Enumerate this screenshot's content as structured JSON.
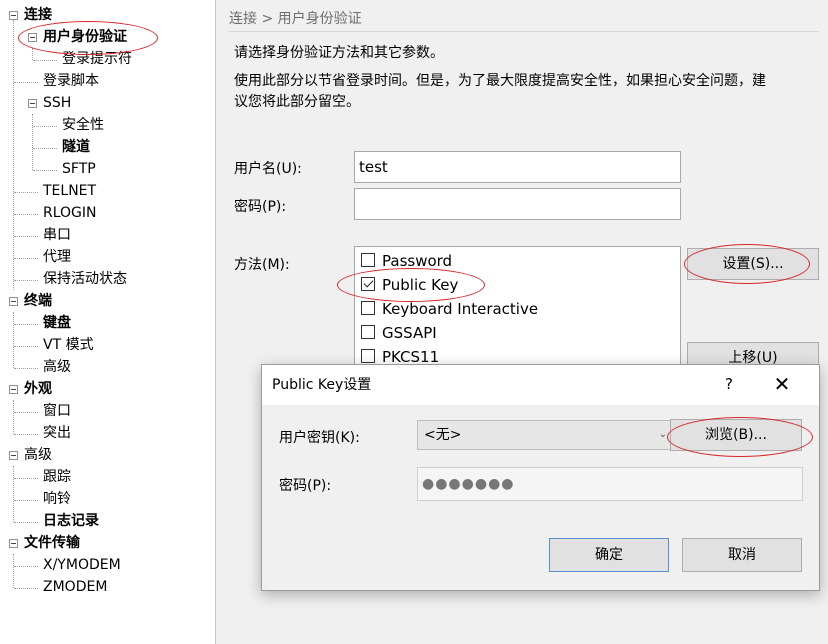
{
  "tree": {
    "items": [
      {
        "label": "连接",
        "bold": true
      },
      {
        "label": "用户身份验证",
        "bold": true
      },
      {
        "label": "登录提示符",
        "bold": false
      },
      {
        "label": "登录脚本",
        "bold": false
      },
      {
        "label": "SSH",
        "bold": false
      },
      {
        "label": "安全性",
        "bold": false
      },
      {
        "label": "隧道",
        "bold": true
      },
      {
        "label": "SFTP",
        "bold": false
      },
      {
        "label": "TELNET",
        "bold": false
      },
      {
        "label": "RLOGIN",
        "bold": false
      },
      {
        "label": "串口",
        "bold": false
      },
      {
        "label": "代理",
        "bold": false
      },
      {
        "label": "保持活动状态",
        "bold": false
      },
      {
        "label": "终端",
        "bold": true
      },
      {
        "label": "键盘",
        "bold": true
      },
      {
        "label": "VT 模式",
        "bold": false
      },
      {
        "label": "高级",
        "bold": false
      },
      {
        "label": "外观",
        "bold": true
      },
      {
        "label": "窗口",
        "bold": false
      },
      {
        "label": "突出",
        "bold": false
      },
      {
        "label": "高级",
        "bold": false
      },
      {
        "label": "跟踪",
        "bold": false
      },
      {
        "label": "响铃",
        "bold": false
      },
      {
        "label": "日志记录",
        "bold": true
      },
      {
        "label": "文件传输",
        "bold": true
      },
      {
        "label": "X/YMODEM",
        "bold": false
      },
      {
        "label": "ZMODEM",
        "bold": false
      }
    ]
  },
  "panel": {
    "breadcrumb": "连接 > 用户身份验证",
    "desc1": "请选择身份验证方法和其它参数。",
    "desc2_line1": "使用此部分以节省登录时间。但是，为了最大限度提高安全性，如果担心安全问题，建",
    "desc2_line2": "议您将此部分留空。",
    "username_label": "用户名(U):",
    "username_value": "test",
    "password_label": "密码(P):",
    "password_value": "",
    "method_label": "方法(M):",
    "methods": [
      {
        "label": "Password",
        "checked": false
      },
      {
        "label": "Public Key",
        "checked": true
      },
      {
        "label": "Keyboard Interactive",
        "checked": false
      },
      {
        "label": "GSSAPI",
        "checked": false
      },
      {
        "label": "PKCS11",
        "checked": false
      }
    ],
    "settings_button": "设置(S)...",
    "move_up_button": "上移(U)"
  },
  "dialog": {
    "title": "Public Key设置",
    "help_icon": "?",
    "close_icon": "✕",
    "user_key_label": "用户密钥(K):",
    "user_key_value": "<无>",
    "browse_button": "浏览(B)...",
    "password_label": "密码(P):",
    "password_mask": "●●●●●●●",
    "ok_button": "确定",
    "cancel_button": "取消"
  },
  "colors": {
    "annotation_ring": "#d6262b",
    "window_bg": "#f0f0f0"
  }
}
